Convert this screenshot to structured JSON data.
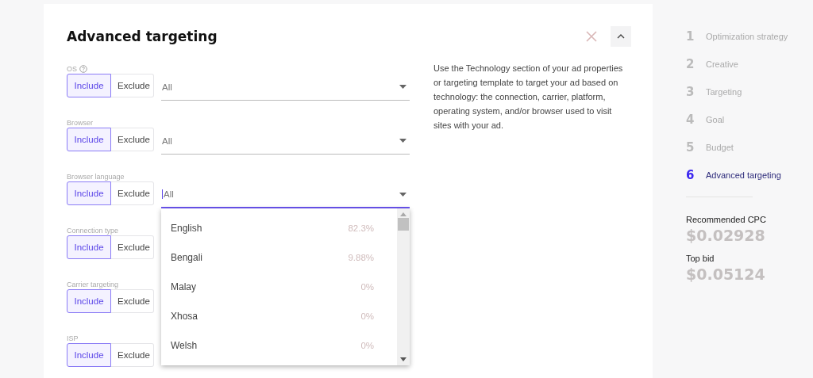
{
  "panel": {
    "title": "Advanced targeting",
    "description": "Use the Technology section of your ad properties or targeting template to target your ad based on technology: the connection, carrier, platform, operating system, and/or browser used to visit sites with your ad."
  },
  "filters": [
    {
      "label": "OS",
      "help": true,
      "modes": [
        {
          "label": "Include",
          "selected": true
        },
        {
          "label": "Exclude",
          "selected": false
        }
      ],
      "select": {
        "value": "All",
        "focused": false
      }
    },
    {
      "label": "Browser",
      "help": false,
      "modes": [
        {
          "label": "Include",
          "selected": true
        },
        {
          "label": "Exclude",
          "selected": false
        }
      ],
      "select": {
        "value": "All",
        "focused": false
      }
    },
    {
      "label": "Browser language",
      "help": false,
      "modes": [
        {
          "label": "Include",
          "selected": true
        },
        {
          "label": "Exclude",
          "selected": false
        }
      ],
      "select": {
        "value": "All",
        "focused": true
      },
      "dropdown": [
        {
          "name": "English",
          "share": "82.3%"
        },
        {
          "name": "Bengali",
          "share": "9.88%"
        },
        {
          "name": "Malay",
          "share": "0%"
        },
        {
          "name": "Xhosa",
          "share": "0%"
        },
        {
          "name": "Welsh",
          "share": "0%"
        }
      ]
    },
    {
      "label": "Connection type",
      "help": false,
      "modes": [
        {
          "label": "Include",
          "selected": true
        },
        {
          "label": "Exclude",
          "selected": false
        }
      ]
    },
    {
      "label": "Carrier targeting",
      "help": false,
      "modes": [
        {
          "label": "Include",
          "selected": true
        },
        {
          "label": "Exclude",
          "selected": false
        }
      ]
    },
    {
      "label": "ISP",
      "help": false,
      "modes": [
        {
          "label": "Include",
          "selected": true
        },
        {
          "label": "Exclude",
          "selected": false
        }
      ]
    }
  ],
  "steps": [
    {
      "number": "1",
      "label": "Optimization strategy",
      "selected": false
    },
    {
      "number": "2",
      "label": "Creative",
      "selected": false
    },
    {
      "number": "3",
      "label": "Targeting",
      "selected": false
    },
    {
      "number": "4",
      "label": "Goal",
      "selected": false
    },
    {
      "number": "5",
      "label": "Budget",
      "selected": false
    },
    {
      "number": "6",
      "label": "Advanced targeting",
      "selected": true
    }
  ],
  "summary": [
    {
      "label": "Recommended CPC",
      "value": "$0.02928"
    },
    {
      "label": "Top bid",
      "value": "$0.05124"
    }
  ]
}
